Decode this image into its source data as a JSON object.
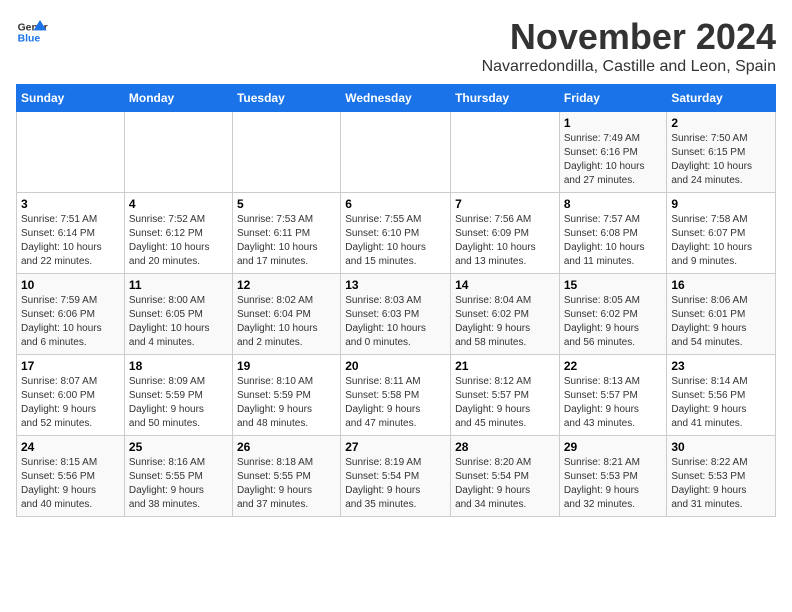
{
  "logo": {
    "line1": "General",
    "line2": "Blue"
  },
  "title": "November 2024",
  "location": "Navarredondilla, Castille and Leon, Spain",
  "headers": [
    "Sunday",
    "Monday",
    "Tuesday",
    "Wednesday",
    "Thursday",
    "Friday",
    "Saturday"
  ],
  "weeks": [
    [
      {
        "day": "",
        "info": ""
      },
      {
        "day": "",
        "info": ""
      },
      {
        "day": "",
        "info": ""
      },
      {
        "day": "",
        "info": ""
      },
      {
        "day": "",
        "info": ""
      },
      {
        "day": "1",
        "info": "Sunrise: 7:49 AM\nSunset: 6:16 PM\nDaylight: 10 hours\nand 27 minutes."
      },
      {
        "day": "2",
        "info": "Sunrise: 7:50 AM\nSunset: 6:15 PM\nDaylight: 10 hours\nand 24 minutes."
      }
    ],
    [
      {
        "day": "3",
        "info": "Sunrise: 7:51 AM\nSunset: 6:14 PM\nDaylight: 10 hours\nand 22 minutes."
      },
      {
        "day": "4",
        "info": "Sunrise: 7:52 AM\nSunset: 6:12 PM\nDaylight: 10 hours\nand 20 minutes."
      },
      {
        "day": "5",
        "info": "Sunrise: 7:53 AM\nSunset: 6:11 PM\nDaylight: 10 hours\nand 17 minutes."
      },
      {
        "day": "6",
        "info": "Sunrise: 7:55 AM\nSunset: 6:10 PM\nDaylight: 10 hours\nand 15 minutes."
      },
      {
        "day": "7",
        "info": "Sunrise: 7:56 AM\nSunset: 6:09 PM\nDaylight: 10 hours\nand 13 minutes."
      },
      {
        "day": "8",
        "info": "Sunrise: 7:57 AM\nSunset: 6:08 PM\nDaylight: 10 hours\nand 11 minutes."
      },
      {
        "day": "9",
        "info": "Sunrise: 7:58 AM\nSunset: 6:07 PM\nDaylight: 10 hours\nand 9 minutes."
      }
    ],
    [
      {
        "day": "10",
        "info": "Sunrise: 7:59 AM\nSunset: 6:06 PM\nDaylight: 10 hours\nand 6 minutes."
      },
      {
        "day": "11",
        "info": "Sunrise: 8:00 AM\nSunset: 6:05 PM\nDaylight: 10 hours\nand 4 minutes."
      },
      {
        "day": "12",
        "info": "Sunrise: 8:02 AM\nSunset: 6:04 PM\nDaylight: 10 hours\nand 2 minutes."
      },
      {
        "day": "13",
        "info": "Sunrise: 8:03 AM\nSunset: 6:03 PM\nDaylight: 10 hours\nand 0 minutes."
      },
      {
        "day": "14",
        "info": "Sunrise: 8:04 AM\nSunset: 6:02 PM\nDaylight: 9 hours\nand 58 minutes."
      },
      {
        "day": "15",
        "info": "Sunrise: 8:05 AM\nSunset: 6:02 PM\nDaylight: 9 hours\nand 56 minutes."
      },
      {
        "day": "16",
        "info": "Sunrise: 8:06 AM\nSunset: 6:01 PM\nDaylight: 9 hours\nand 54 minutes."
      }
    ],
    [
      {
        "day": "17",
        "info": "Sunrise: 8:07 AM\nSunset: 6:00 PM\nDaylight: 9 hours\nand 52 minutes."
      },
      {
        "day": "18",
        "info": "Sunrise: 8:09 AM\nSunset: 5:59 PM\nDaylight: 9 hours\nand 50 minutes."
      },
      {
        "day": "19",
        "info": "Sunrise: 8:10 AM\nSunset: 5:59 PM\nDaylight: 9 hours\nand 48 minutes."
      },
      {
        "day": "20",
        "info": "Sunrise: 8:11 AM\nSunset: 5:58 PM\nDaylight: 9 hours\nand 47 minutes."
      },
      {
        "day": "21",
        "info": "Sunrise: 8:12 AM\nSunset: 5:57 PM\nDaylight: 9 hours\nand 45 minutes."
      },
      {
        "day": "22",
        "info": "Sunrise: 8:13 AM\nSunset: 5:57 PM\nDaylight: 9 hours\nand 43 minutes."
      },
      {
        "day": "23",
        "info": "Sunrise: 8:14 AM\nSunset: 5:56 PM\nDaylight: 9 hours\nand 41 minutes."
      }
    ],
    [
      {
        "day": "24",
        "info": "Sunrise: 8:15 AM\nSunset: 5:56 PM\nDaylight: 9 hours\nand 40 minutes."
      },
      {
        "day": "25",
        "info": "Sunrise: 8:16 AM\nSunset: 5:55 PM\nDaylight: 9 hours\nand 38 minutes."
      },
      {
        "day": "26",
        "info": "Sunrise: 8:18 AM\nSunset: 5:55 PM\nDaylight: 9 hours\nand 37 minutes."
      },
      {
        "day": "27",
        "info": "Sunrise: 8:19 AM\nSunset: 5:54 PM\nDaylight: 9 hours\nand 35 minutes."
      },
      {
        "day": "28",
        "info": "Sunrise: 8:20 AM\nSunset: 5:54 PM\nDaylight: 9 hours\nand 34 minutes."
      },
      {
        "day": "29",
        "info": "Sunrise: 8:21 AM\nSunset: 5:53 PM\nDaylight: 9 hours\nand 32 minutes."
      },
      {
        "day": "30",
        "info": "Sunrise: 8:22 AM\nSunset: 5:53 PM\nDaylight: 9 hours\nand 31 minutes."
      }
    ]
  ]
}
